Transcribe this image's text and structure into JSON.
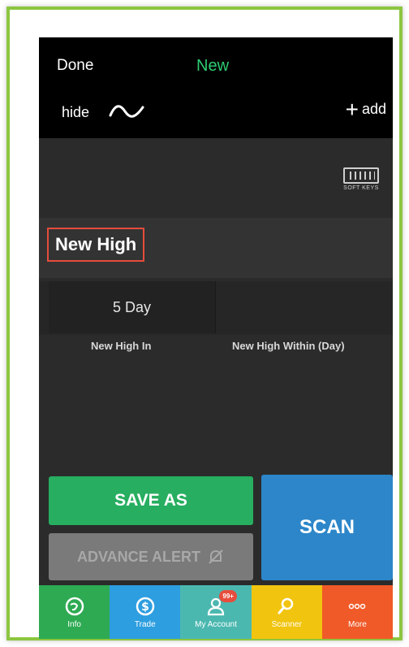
{
  "header": {
    "done_label": "Done",
    "title": "New",
    "hide_label": "hide",
    "add_label": "add"
  },
  "keyboard": {
    "caption": "SOFT KEYS"
  },
  "section": {
    "title": "New High"
  },
  "params": {
    "value": "5 Day",
    "label_1": "New High In",
    "label_2": "New High Within (Day)"
  },
  "actions": {
    "save_as": "SAVE AS",
    "advance_alert": "ADVANCE ALERT",
    "scan": "SCAN"
  },
  "nav": {
    "items": [
      {
        "label": "Info",
        "icon": "globe-icon"
      },
      {
        "label": "Trade",
        "icon": "dollar-icon"
      },
      {
        "label": "My Account",
        "icon": "user-icon",
        "badge": "99+"
      },
      {
        "label": "Scanner",
        "icon": "magnifier-icon"
      },
      {
        "label": "More",
        "icon": "more-dots-icon"
      }
    ]
  },
  "colors": {
    "accent_green": "#2ecc71",
    "save_green": "#27ae60",
    "scan_blue": "#2d86c9",
    "highlight_red": "#e74c3c",
    "frame_green": "#8cc63f"
  }
}
